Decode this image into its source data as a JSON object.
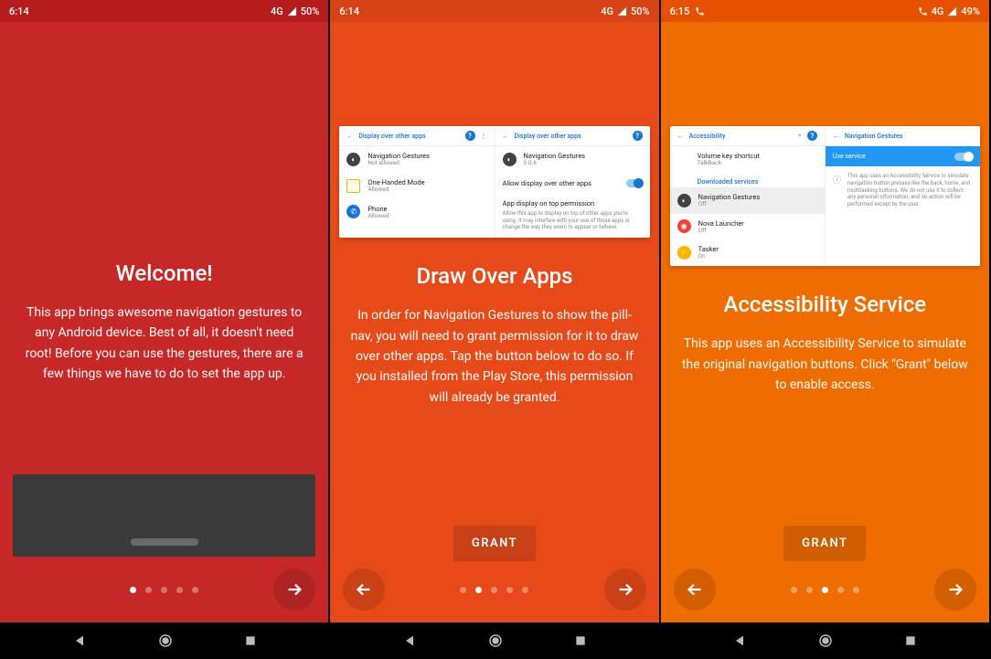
{
  "screens": [
    {
      "status": {
        "time": "6:14",
        "net": "4G",
        "battery": "50%"
      },
      "title": "Welcome!",
      "body": "This app brings awesome navigation gestures to any Android device. Best of all, it doesn't need root! Before you can use the gestures, there are a few things we have to do to set the app up.",
      "dots_active": 0
    },
    {
      "status": {
        "time": "6:14",
        "net": "4G",
        "battery": "50%"
      },
      "title": "Draw Over Apps",
      "body": "In order for Navigation Gestures to show the pill-nav, you will need to grant permission for it to draw over other apps. Tap the button below to do so. If you installed from the Play Store, this permission will already be granted.",
      "grant": "GRANT",
      "dots_active": 1,
      "embed": {
        "left": {
          "header": "Display over other apps",
          "items": [
            {
              "title": "Navigation Gestures",
              "sub": "Not allowed",
              "icon": "nav"
            },
            {
              "title": "One-Handed Mode",
              "sub": "Allowed",
              "icon": "ohm"
            },
            {
              "title": "Phone",
              "sub": "Allowed",
              "icon": "phone"
            }
          ]
        },
        "right": {
          "header": "Display over other apps",
          "app": {
            "title": "Navigation Gestures",
            "sub": "0.0.6"
          },
          "toggle_label": "Allow display over other apps",
          "perm_label": "App display on top permission",
          "perm_desc": "Allow this app to display on top of other apps you're using. It may interfere with your use of those apps or change the way they seem to appear or behave."
        }
      }
    },
    {
      "status": {
        "time": "6:15",
        "net": "4G",
        "battery": "49%"
      },
      "title": "Accessibility Service",
      "body": "This app uses an Accessibility Service to simulate the original navigation buttons. Click \"Grant\" below to enable access.",
      "grant": "GRANT",
      "dots_active": 2,
      "embed": {
        "left": {
          "header": "Accessibility",
          "top": {
            "title": "Volume key shortcut",
            "sub": "TalkBack"
          },
          "section": "Downloaded services",
          "items": [
            {
              "title": "Navigation Gestures",
              "sub": "Off",
              "icon": "nav",
              "selected": true
            },
            {
              "title": "Nova Launcher",
              "sub": "Off",
              "icon": "nova"
            },
            {
              "title": "Tasker",
              "sub": "On",
              "icon": "tasker"
            }
          ]
        },
        "right": {
          "header": "Navigation Gestures",
          "toggle_label": "Use service",
          "desc": "This app uses an Accessibility Service to simulate navigation button presses like the back, home, and multitasking buttons. We do not use it to collect any personal information, and no action will be performed except by the user."
        }
      }
    }
  ]
}
